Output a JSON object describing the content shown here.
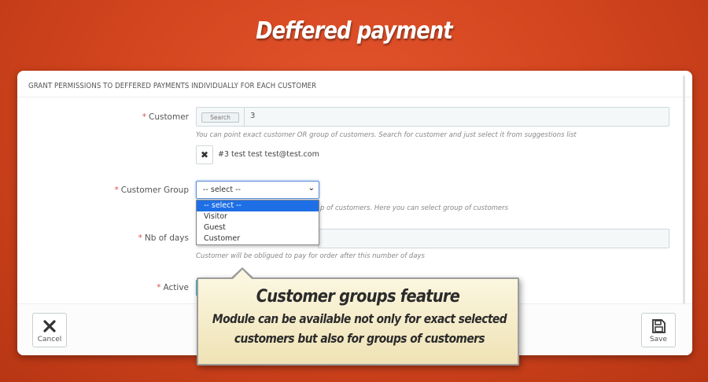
{
  "banner": {
    "title": "Deffered payment"
  },
  "panel": {
    "header": "GRANT PERMISSIONS TO DEFFERED PAYMENTS INDIVIDUALLY FOR EACH CUSTOMER",
    "customer": {
      "label": "Customer",
      "search_addon": "Search",
      "value": "3",
      "help": "You can point exact customer OR group of customers. Search for customer and just select it from suggestions list",
      "token_text": "#3 test test test@test.com",
      "token_remove_glyph": "✖"
    },
    "customer_group": {
      "label": "Customer Group",
      "selected": "-- select --",
      "options": [
        "-- select --",
        "Visitor",
        "Guest",
        "Customer"
      ],
      "help_partial": "p of customers. Here you can select group of customers"
    },
    "nb_days": {
      "label": "Nb of days",
      "help": "Customer will be obligued to pay for order after this number of days"
    },
    "active": {
      "label": "Active"
    },
    "required_mark": "*",
    "footer": {
      "cancel_label": "Cancel",
      "save_label": "Save"
    }
  },
  "callout": {
    "title": "Customer groups feature",
    "line1": "Module can be available not only for exact selected",
    "line2": "customers but also for groups of customers"
  },
  "colors": {
    "background": "#d4461f",
    "accent": "#25b9d7",
    "required": "#d9534f",
    "dropdown_selected": "#1e6fe6"
  }
}
